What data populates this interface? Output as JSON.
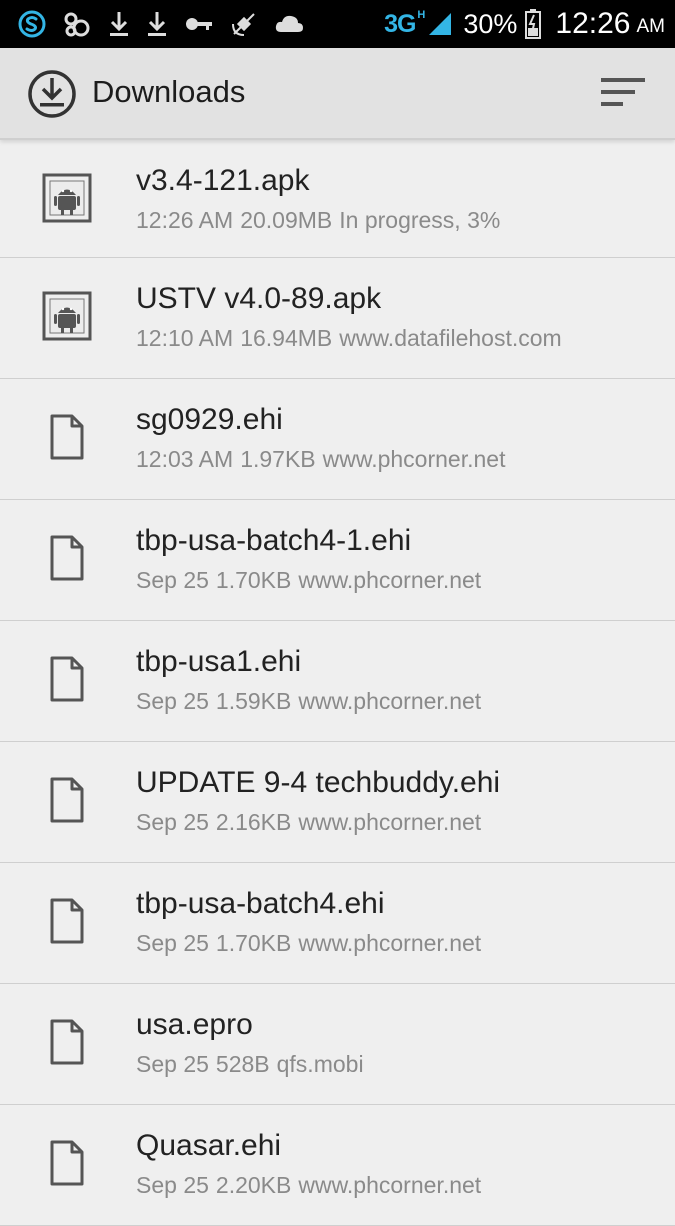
{
  "status_bar": {
    "network": "3G",
    "network_sup": "H",
    "battery": "30%",
    "time": "12:26",
    "ampm": "AM",
    "icons": [
      "skype-icon",
      "infinity-icon",
      "download-icon",
      "download-icon",
      "key-icon",
      "satellite-icon",
      "cloud-icon"
    ]
  },
  "app_bar": {
    "title": "Downloads",
    "icon": "download-icon",
    "sort_icon": "sort-icon"
  },
  "downloads": [
    {
      "name": "v3.4-121.apk",
      "time": "12:26 AM",
      "size": "20.09MB",
      "info": "In progress, 3%",
      "icon": "android-icon"
    },
    {
      "name": "USTV v4.0-89.apk",
      "time": "12:10 AM",
      "size": "16.94MB",
      "info": "www.datafilehost.com",
      "icon": "android-icon"
    },
    {
      "name": "sg0929.ehi",
      "time": "12:03 AM",
      "size": "1.97KB",
      "info": "www.phcorner.net",
      "icon": "file-icon"
    },
    {
      "name": "tbp-usa-batch4-1.ehi",
      "time": "Sep 25",
      "size": "1.70KB",
      "info": "www.phcorner.net",
      "icon": "file-icon"
    },
    {
      "name": "tbp-usa1.ehi",
      "time": "Sep 25",
      "size": "1.59KB",
      "info": "www.phcorner.net",
      "icon": "file-icon"
    },
    {
      "name": "UPDATE 9-4 techbuddy.ehi",
      "time": "Sep 25",
      "size": "2.16KB",
      "info": "www.phcorner.net",
      "icon": "file-icon"
    },
    {
      "name": "tbp-usa-batch4.ehi",
      "time": "Sep 25",
      "size": "1.70KB",
      "info": "www.phcorner.net",
      "icon": "file-icon"
    },
    {
      "name": "usa.epro",
      "time": "Sep 25",
      "size": "528B",
      "info": "qfs.mobi",
      "icon": "file-icon"
    },
    {
      "name": "Quasar.ehi",
      "time": "Sep 25",
      "size": "2.20KB",
      "info": "www.phcorner.net",
      "icon": "file-icon"
    }
  ]
}
